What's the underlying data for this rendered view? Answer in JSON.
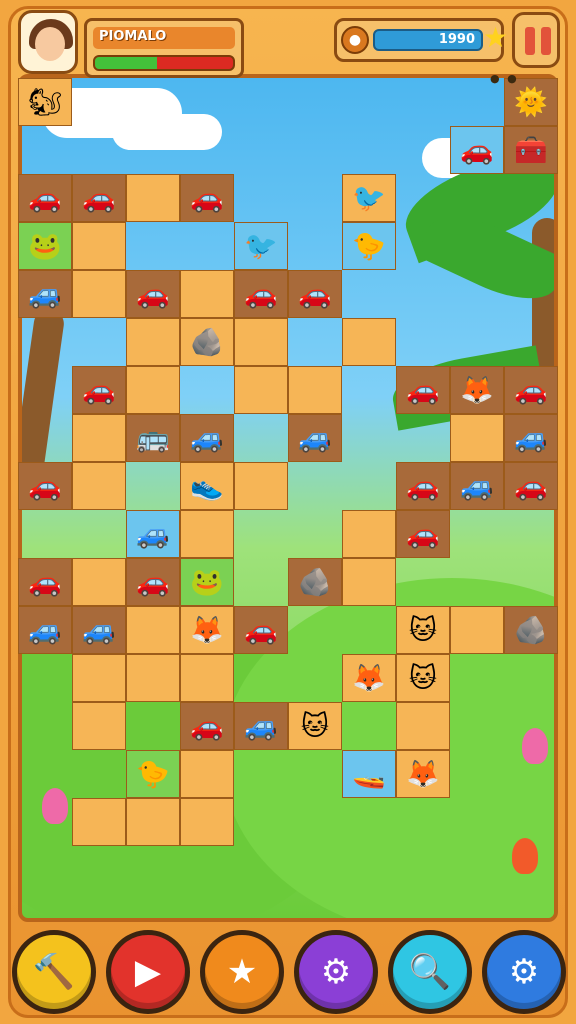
{
  "hud": {
    "player_name": "PIOMALO",
    "health_fraction": 0.45,
    "score": "1990",
    "coin_icon": "coin-icon",
    "star_icon": "star-icon",
    "dots": "● ●"
  },
  "tokens": {
    "car": "🚗",
    "car_blue": "🚙",
    "bus": "🚌",
    "fox": "🦊",
    "bird": "🐦",
    "chick": "🐤",
    "cat": "🐱",
    "frog": "🐸",
    "rock": "🪨",
    "shoe": "👟",
    "sun": "🌞",
    "boat": "🚤",
    "tool": "🧰",
    "squirrel": "🐿"
  },
  "buttons": [
    {
      "name": "hammer-button",
      "icon": "🔨",
      "color": "#f4c21d"
    },
    {
      "name": "rocket-button",
      "icon": "▶",
      "color": "#e2332c"
    },
    {
      "name": "star-button",
      "icon": "★",
      "color": "#f08a1c"
    },
    {
      "name": "gear-button",
      "icon": "⚙",
      "color": "#8b3fd6"
    },
    {
      "name": "magnifier-button",
      "icon": "🔍",
      "color": "#2fc6e3"
    },
    {
      "name": "settings-button",
      "icon": "⚙",
      "color": "#2f7be0"
    }
  ],
  "board": [
    [
      0,
      0,
      "empty",
      "squirrel"
    ],
    [
      0,
      9,
      "dark",
      "sun"
    ],
    [
      1,
      8,
      "blue",
      "car"
    ],
    [
      1,
      9,
      "dark",
      "tool"
    ],
    [
      2,
      0,
      "dark",
      "car"
    ],
    [
      2,
      1,
      "dark",
      "car"
    ],
    [
      2,
      2,
      "empty",
      ""
    ],
    [
      2,
      3,
      "dark",
      "car"
    ],
    [
      2,
      6,
      "empty",
      "bird"
    ],
    [
      3,
      0,
      "green",
      "frog"
    ],
    [
      3,
      1,
      "empty",
      ""
    ],
    [
      3,
      4,
      "blue",
      "bird"
    ],
    [
      3,
      6,
      "blue",
      "chick"
    ],
    [
      4,
      0,
      "dark",
      "car_blue"
    ],
    [
      4,
      1,
      "empty",
      ""
    ],
    [
      4,
      2,
      "dark",
      "car"
    ],
    [
      4,
      3,
      "empty",
      ""
    ],
    [
      4,
      4,
      "dark",
      "car"
    ],
    [
      4,
      5,
      "dark",
      "car"
    ],
    [
      5,
      2,
      "empty",
      ""
    ],
    [
      5,
      3,
      "empty",
      "rock"
    ],
    [
      5,
      4,
      "empty",
      ""
    ],
    [
      5,
      6,
      "empty",
      ""
    ],
    [
      6,
      1,
      "dark",
      "car"
    ],
    [
      6,
      2,
      "empty",
      ""
    ],
    [
      6,
      4,
      "empty",
      ""
    ],
    [
      6,
      5,
      "empty",
      ""
    ],
    [
      6,
      7,
      "dark",
      "car"
    ],
    [
      6,
      8,
      "dark",
      "fox"
    ],
    [
      6,
      9,
      "dark",
      "car"
    ],
    [
      7,
      1,
      "empty",
      ""
    ],
    [
      7,
      2,
      "dark",
      "bus"
    ],
    [
      7,
      3,
      "dark",
      "car_blue"
    ],
    [
      7,
      5,
      "dark",
      "car_blue"
    ],
    [
      7,
      8,
      "empty",
      ""
    ],
    [
      7,
      9,
      "dark",
      "car_blue"
    ],
    [
      8,
      0,
      "dark",
      "car"
    ],
    [
      8,
      1,
      "empty",
      ""
    ],
    [
      8,
      3,
      "empty",
      "shoe"
    ],
    [
      8,
      4,
      "empty",
      ""
    ],
    [
      8,
      7,
      "dark",
      "car"
    ],
    [
      8,
      8,
      "dark",
      "car_blue"
    ],
    [
      8,
      9,
      "dark",
      "car"
    ],
    [
      9,
      2,
      "blue",
      "car_blue"
    ],
    [
      9,
      3,
      "empty",
      ""
    ],
    [
      9,
      6,
      "empty",
      ""
    ],
    [
      9,
      7,
      "dark",
      "car"
    ],
    [
      10,
      0,
      "dark",
      "car"
    ],
    [
      10,
      1,
      "empty",
      ""
    ],
    [
      10,
      2,
      "dark",
      "car"
    ],
    [
      10,
      3,
      "green",
      "frog"
    ],
    [
      10,
      5,
      "dark",
      "rock"
    ],
    [
      10,
      6,
      "empty",
      ""
    ],
    [
      11,
      0,
      "dark",
      "car_blue"
    ],
    [
      11,
      1,
      "dark",
      "car_blue"
    ],
    [
      11,
      2,
      "empty",
      ""
    ],
    [
      11,
      3,
      "empty",
      "fox"
    ],
    [
      11,
      4,
      "dark",
      "car"
    ],
    [
      11,
      7,
      "empty",
      "cat"
    ],
    [
      11,
      8,
      "empty",
      ""
    ],
    [
      11,
      9,
      "dark",
      "rock"
    ],
    [
      12,
      1,
      "empty",
      ""
    ],
    [
      12,
      2,
      "empty",
      ""
    ],
    [
      12,
      3,
      "empty",
      ""
    ],
    [
      12,
      6,
      "empty",
      "fox"
    ],
    [
      12,
      7,
      "empty",
      "cat"
    ],
    [
      13,
      1,
      "empty",
      ""
    ],
    [
      13,
      3,
      "dark",
      "car"
    ],
    [
      13,
      4,
      "dark",
      "car_blue"
    ],
    [
      13,
      5,
      "empty",
      "cat"
    ],
    [
      13,
      7,
      "empty",
      ""
    ],
    [
      14,
      2,
      "green",
      "chick"
    ],
    [
      14,
      3,
      "empty",
      ""
    ],
    [
      14,
      6,
      "blue",
      "boat"
    ],
    [
      14,
      7,
      "empty",
      "fox"
    ],
    [
      15,
      1,
      "empty",
      ""
    ],
    [
      15,
      2,
      "empty",
      ""
    ],
    [
      15,
      3,
      "empty",
      ""
    ]
  ]
}
